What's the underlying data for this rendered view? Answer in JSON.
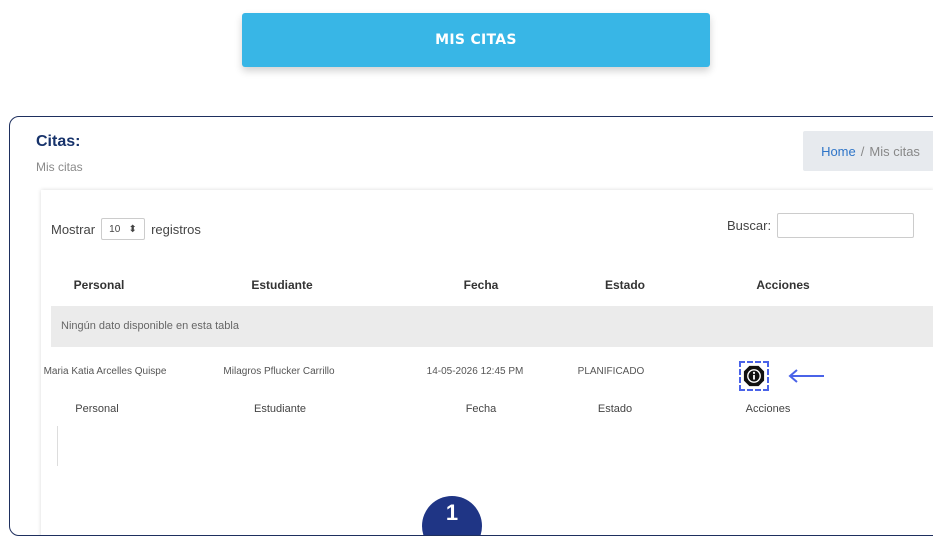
{
  "header_button": {
    "label": "MIS CITAS"
  },
  "page": {
    "title": "Citas:",
    "subtitle": "Mis citas"
  },
  "breadcrumb": {
    "home": "Home",
    "separator": "/",
    "current": "Mis citas"
  },
  "table_controls": {
    "show_label": "Mostrar",
    "page_length": "10",
    "records_label": "registros",
    "search_label": "Buscar:",
    "search_value": ""
  },
  "table": {
    "columns": [
      "Personal",
      "Estudiante",
      "Fecha",
      "Estado",
      "Acciones"
    ],
    "empty_message": "Ningún dato disponible en esta tabla",
    "row": {
      "personal": "Maria Katia Arcelles Quispe",
      "estudiante": "Milagros Pflucker Carrillo",
      "fecha": "14-05-2026 12:45 PM",
      "estado": "PLANIFICADO"
    },
    "footer_columns": [
      "Personal",
      "Estudiante",
      "Fecha",
      "Estado",
      "Acciones"
    ]
  },
  "icons": {
    "action": "info-icon",
    "pointer": "arrow-left-icon",
    "sort": "sort-arrows-icon"
  },
  "colors": {
    "button": "#38b6e6",
    "title": "#17336b",
    "highlight": "#4a63e8",
    "step": "#1f3585"
  }
}
